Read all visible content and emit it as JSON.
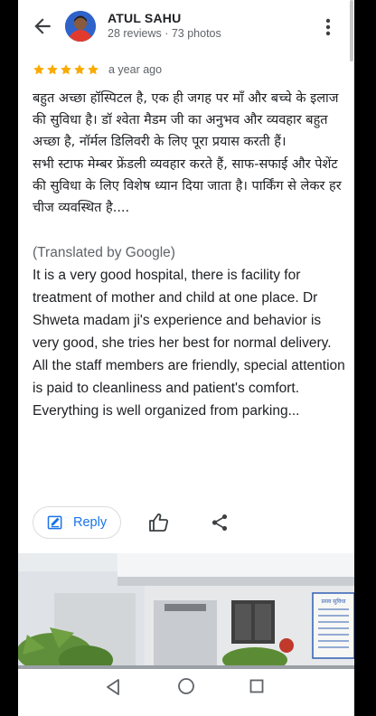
{
  "reviewer": {
    "name": "ATUL SAHU",
    "stats": "28 reviews · 73 photos",
    "avatar_icon": "avatar"
  },
  "header": {
    "back_icon": "arrow-back-icon",
    "more_icon": "more-vert-icon"
  },
  "rating": {
    "stars": 5,
    "star_color": "#f9ab00",
    "time": "a year ago"
  },
  "review": {
    "original_hindi": "बहुत अच्छा हॉस्पिटल है, एक ही जगह पर माँ और बच्चे के इलाज की सुविधा है। डॉ श्वेता मैडम जी का अनुभव और व्यवहार बहुत अच्छा है, नॉर्मल डिलिवरी के लिए पूरा प्रयास करती हैं।\nसभी स्टाफ मेम्बर फ्रेंडली व्यवहार करते हैं, साफ-सफाई और पेशेंट की सुविधा के लिए विशेष ध्यान दिया जाता है। पार्किंग से लेकर हर चीज व्यवस्थित है....",
    "translated_label": "(Translated by Google)",
    "translated_text": "It is a very good hospital, there is facility for treatment of mother and child at one place. Dr Shweta madam ji's experience and behavior is very good, she tries her best for normal delivery.\nAll the staff members are friendly, special attention is paid to cleanliness and patient's comfort. Everything is well organized from parking..."
  },
  "actions": {
    "reply_label": "Reply",
    "reply_color": "#1a73e8",
    "like_icon": "thumb-up-icon",
    "share_icon": "share-icon"
  },
  "photo": {
    "sign_text": "प्रसव सुविधा"
  },
  "navbar": {
    "back_icon": "nav-back-icon",
    "home_icon": "nav-home-icon",
    "recents_icon": "nav-recents-icon"
  }
}
